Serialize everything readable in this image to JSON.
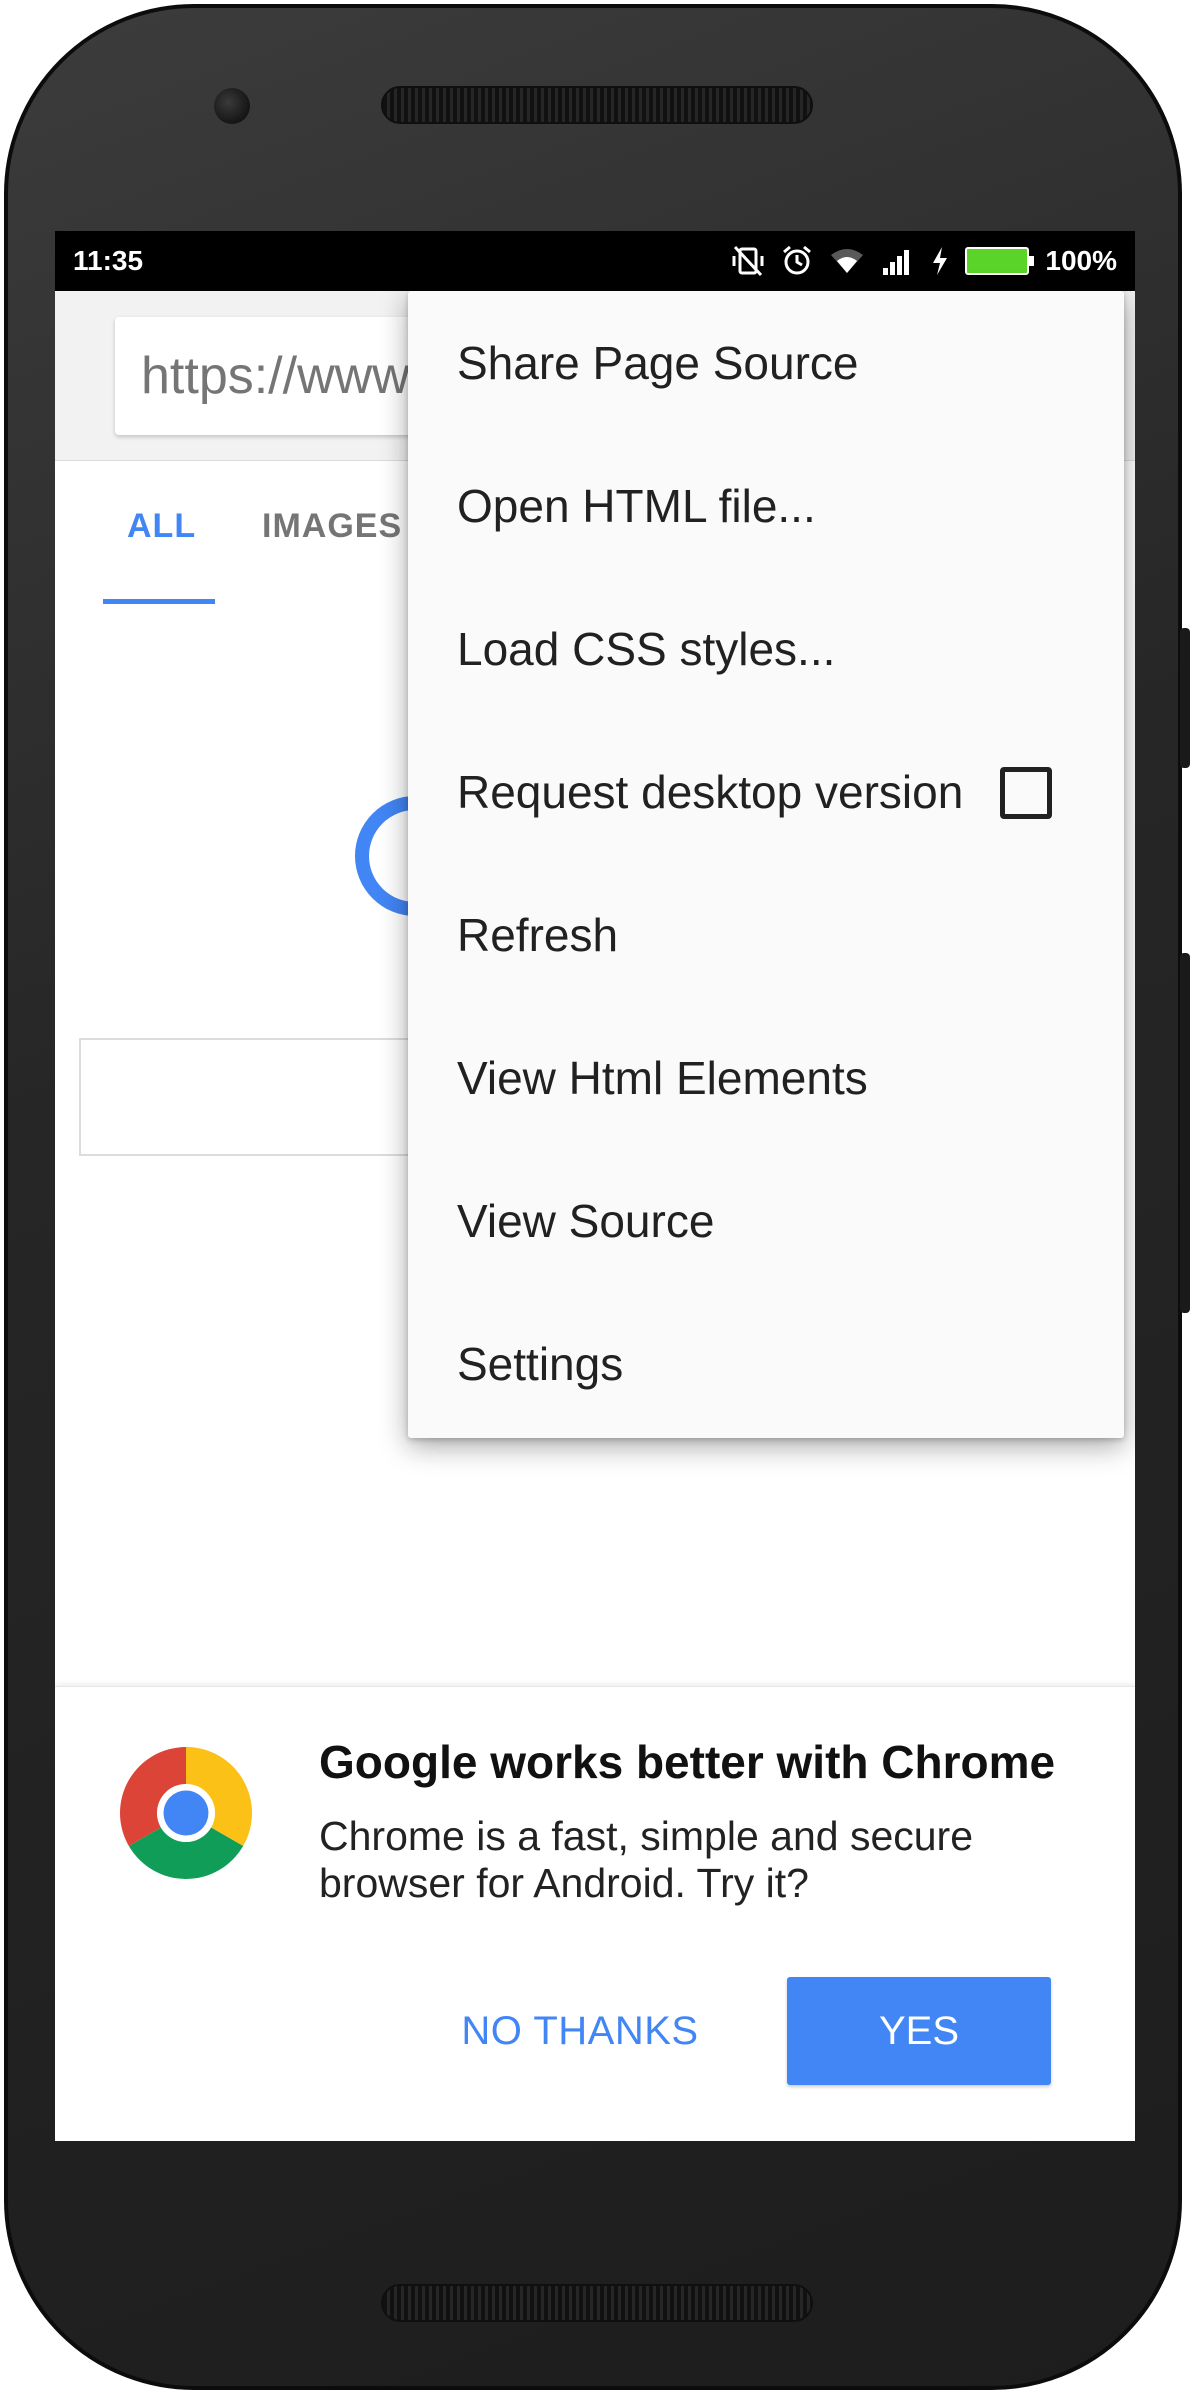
{
  "status_bar": {
    "time": "11:35",
    "battery_percent": "100%"
  },
  "browser": {
    "url_text": "https://www"
  },
  "search_tabs": [
    {
      "label": "ALL",
      "active": true
    },
    {
      "label": "IMAGES",
      "active": false
    }
  ],
  "menu": {
    "items": [
      {
        "label": "Share Page Source"
      },
      {
        "label": "Open HTML file..."
      },
      {
        "label": "Load CSS styles..."
      },
      {
        "label": "Request desktop version",
        "checkbox": true,
        "checked": false
      },
      {
        "label": "Refresh"
      },
      {
        "label": "View Html Elements"
      },
      {
        "label": "View Source"
      },
      {
        "label": "Settings"
      }
    ]
  },
  "banner": {
    "title": "Google works better with Chrome",
    "body": "Chrome is a fast, simple and secure browser for Android. Try it?",
    "decline_label": "NO THANKS",
    "accept_label": "YES"
  },
  "colors": {
    "accent": "#4285f4",
    "battery": "#5bd42a",
    "menu_background": "#fafafa"
  },
  "icons": [
    "vibrate-off-icon",
    "alarm-icon",
    "wifi-icon",
    "cell-signal-icon",
    "charging-icon",
    "battery-icon",
    "chrome-logo-icon",
    "checkbox-icon"
  ]
}
